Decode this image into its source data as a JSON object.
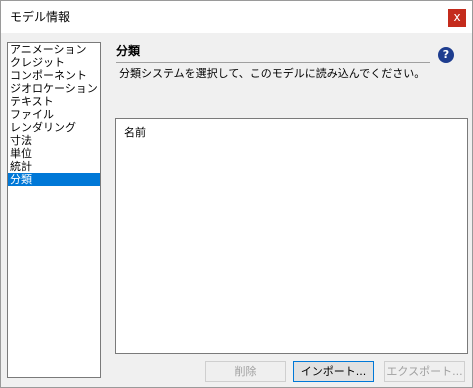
{
  "window": {
    "title": "モデル情報",
    "close_glyph": "x"
  },
  "sidebar": {
    "items": [
      {
        "label": "アニメーション",
        "selected": false
      },
      {
        "label": "クレジット",
        "selected": false
      },
      {
        "label": "コンポーネント",
        "selected": false
      },
      {
        "label": "ジオロケーション",
        "selected": false
      },
      {
        "label": "テキスト",
        "selected": false
      },
      {
        "label": "ファイル",
        "selected": false
      },
      {
        "label": "レンダリング",
        "selected": false
      },
      {
        "label": "寸法",
        "selected": false
      },
      {
        "label": "単位",
        "selected": false
      },
      {
        "label": "統計",
        "selected": false
      },
      {
        "label": "分類",
        "selected": true
      }
    ]
  },
  "panel": {
    "title": "分類",
    "description": "分類システムを選択して、このモデルに読み込んでください。",
    "help_glyph": "?",
    "list_header": "名前"
  },
  "buttons": {
    "delete_label": "削除",
    "import_label": "インポート...",
    "export_label": "エクスポート..."
  },
  "colors": {
    "selection": "#0078d7",
    "close": "#c42b1c",
    "help": "#1e3d8f"
  },
  "icons": {
    "help": "help-icon",
    "close": "close-icon"
  }
}
